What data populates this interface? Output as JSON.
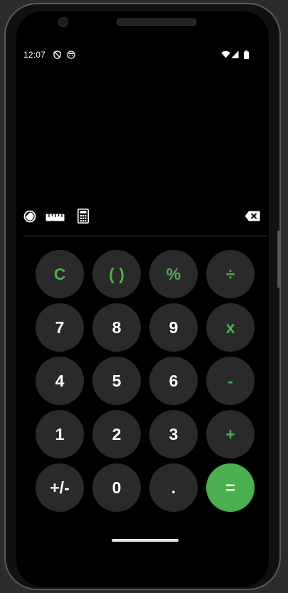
{
  "status_bar": {
    "time": "12:07",
    "left_icons": [
      "shield-icon",
      "face-icon"
    ],
    "right_icons": [
      "wifi-icon",
      "signal-icon",
      "battery-icon"
    ]
  },
  "toolbar": {
    "left_icons": [
      "theme-toggle-icon",
      "ruler-icon",
      "calculator-icon"
    ],
    "right_icon": "backspace-icon"
  },
  "keypad": {
    "rows": [
      [
        {
          "label": "C",
          "name": "clear-button",
          "kind": "op"
        },
        {
          "label": "( )",
          "name": "parentheses-button",
          "kind": "op"
        },
        {
          "label": "%",
          "name": "percent-button",
          "kind": "op"
        },
        {
          "label": "÷",
          "name": "divide-button",
          "kind": "op"
        }
      ],
      [
        {
          "label": "7",
          "name": "digit-7-button",
          "kind": "num"
        },
        {
          "label": "8",
          "name": "digit-8-button",
          "kind": "num"
        },
        {
          "label": "9",
          "name": "digit-9-button",
          "kind": "num"
        },
        {
          "label": "x",
          "name": "multiply-button",
          "kind": "op"
        }
      ],
      [
        {
          "label": "4",
          "name": "digit-4-button",
          "kind": "num"
        },
        {
          "label": "5",
          "name": "digit-5-button",
          "kind": "num"
        },
        {
          "label": "6",
          "name": "digit-6-button",
          "kind": "num"
        },
        {
          "label": "-",
          "name": "subtract-button",
          "kind": "op"
        }
      ],
      [
        {
          "label": "1",
          "name": "digit-1-button",
          "kind": "num"
        },
        {
          "label": "2",
          "name": "digit-2-button",
          "kind": "num"
        },
        {
          "label": "3",
          "name": "digit-3-button",
          "kind": "num"
        },
        {
          "label": "+",
          "name": "add-button",
          "kind": "op"
        }
      ],
      [
        {
          "label": "+/-",
          "name": "negate-button",
          "kind": "num"
        },
        {
          "label": "0",
          "name": "digit-0-button",
          "kind": "num"
        },
        {
          "label": ".",
          "name": "decimal-button",
          "kind": "num"
        },
        {
          "label": "=",
          "name": "equals-button",
          "kind": "equals"
        }
      ]
    ]
  },
  "colors": {
    "accent": "#4caf50",
    "key_background": "#2a2a2a",
    "screen_background": "#000000"
  }
}
